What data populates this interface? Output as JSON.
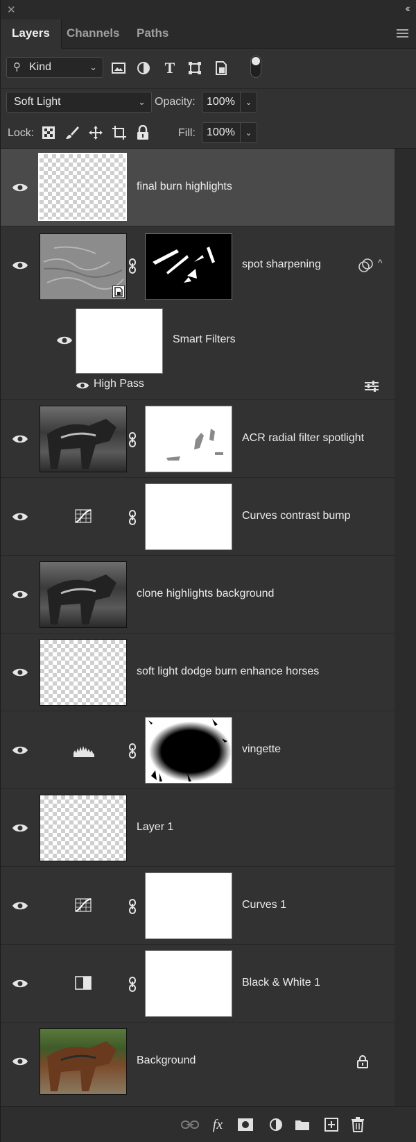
{
  "tabs": [
    {
      "label": "Layers",
      "active": true
    },
    {
      "label": "Channels",
      "active": false
    },
    {
      "label": "Paths",
      "active": false
    }
  ],
  "filter": {
    "kind_label": "Kind",
    "filter_icons": [
      "image-filter-icon",
      "adjustment-filter-icon",
      "type-filter-icon",
      "shape-filter-icon",
      "smart-object-filter-icon"
    ]
  },
  "blend_mode": "Soft Light",
  "opacity": {
    "label": "Opacity:",
    "value": "100%"
  },
  "lock": {
    "label": "Lock:",
    "icons": [
      "lock-transparent-pixels-icon",
      "lock-image-pixels-icon",
      "lock-position-icon",
      "lock-artboard-icon",
      "lock-all-icon"
    ]
  },
  "fill": {
    "label": "Fill:",
    "value": "100%"
  },
  "layers": [
    {
      "name": "final burn highlights",
      "thumb": "checker",
      "selected": true
    },
    {
      "name": "spot sharpening",
      "thumb": "noise",
      "mask": "black-streaks",
      "smart_object": true
    },
    {
      "name": "Smart Filters",
      "sub": true,
      "filter": "High Pass"
    },
    {
      "name": "ACR radial filter spotlight",
      "thumb": "photo",
      "mask": "white-marks"
    },
    {
      "name": "Curves  contrast bump",
      "icon": "curves-adjustment-icon",
      "mask": "white"
    },
    {
      "name": "clone highlights background",
      "thumb": "photo"
    },
    {
      "name": "soft light dodge burn enhance horses",
      "thumb": "checker"
    },
    {
      "name": "vingette",
      "icon": "levels-adjustment-icon",
      "mask": "vignette"
    },
    {
      "name": "Layer 1",
      "thumb": "checker"
    },
    {
      "name": "Curves 1",
      "icon": "curves-adjustment-icon",
      "mask": "white"
    },
    {
      "name": "Black & White 1",
      "icon": "black-white-adjustment-icon",
      "mask": "white"
    },
    {
      "name": "Background",
      "thumb": "photo-color",
      "locked": true
    }
  ],
  "bottom_icons": [
    "link-layers-icon",
    "fx-icon",
    "add-mask-icon",
    "new-adjustment-icon",
    "new-group-icon",
    "new-layer-icon",
    "delete-layer-icon"
  ]
}
